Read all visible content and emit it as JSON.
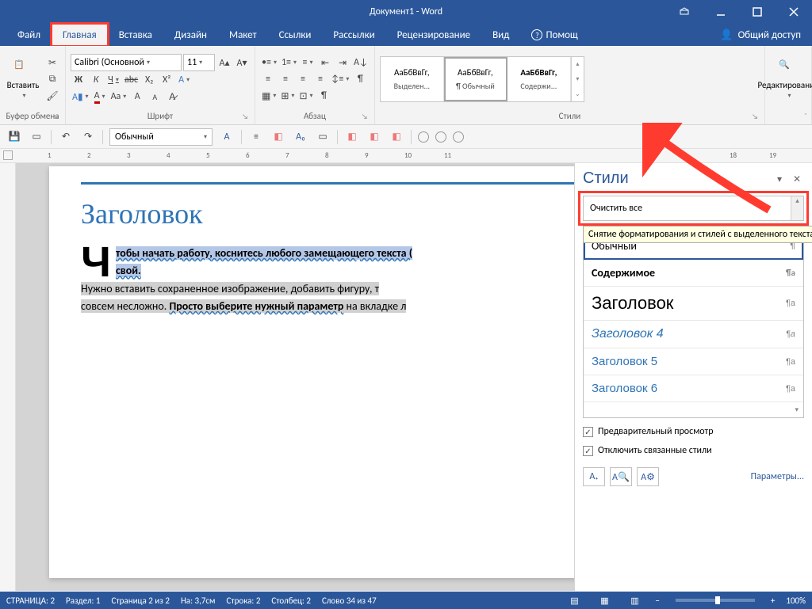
{
  "title": "Документ1 - Word",
  "tabs": [
    "Файл",
    "Главная",
    "Вставка",
    "Дизайн",
    "Макет",
    "Ссылки",
    "Рассылки",
    "Рецензирование",
    "Вид",
    "Помощ"
  ],
  "active_tab": 1,
  "share": "Общий доступ",
  "ribbon": {
    "clipboard": {
      "paste": "Вставить",
      "label": "Буфер обмена"
    },
    "font": {
      "name": "Calibri (Основной",
      "size": "11",
      "label": "Шрифт"
    },
    "para": {
      "label": "Абзац"
    },
    "styles": {
      "label": "Стили",
      "tiles": [
        {
          "preview": "АаБбВвГг,",
          "name": "Выделен..."
        },
        {
          "preview": "АаБбВвГг,",
          "name": "¶ Обычный",
          "selected": true
        },
        {
          "preview": "АаБбВвГг,",
          "name": "Содержи...",
          "bold": true
        }
      ]
    },
    "editing": {
      "label": "Редактирование"
    }
  },
  "qat_style": "Обычный",
  "ruler_numbers": [
    1,
    2,
    3,
    4,
    5,
    6,
    7,
    8,
    9,
    10,
    11,
    18,
    19
  ],
  "doc": {
    "heading": "Заголовок",
    "line1a": "тобы начать работу, коснитесь любого замещающего текста (",
    "line1b": "свой.",
    "line2a": "Нужно вставить сохраненное изображение, добавить фигуру, т",
    "line2b": "совсем несложно. ",
    "line2c": "Просто выберите нужный параметр",
    "line2d": " на вкладке л"
  },
  "pane": {
    "title": "Стили",
    "clear": "Очистить все",
    "tooltip": "Снятие форматирования и стилей с выделенного текста",
    "items": [
      {
        "label": "Обычный",
        "mark": "¶",
        "selected": true
      },
      {
        "label": "Содержимое",
        "mark": "¶a",
        "cls": "bold"
      },
      {
        "label": "Заголовок",
        "mark": "¶a",
        "cls": "h1"
      },
      {
        "label": "Заголовок 4",
        "mark": "¶a",
        "cls": "h4"
      },
      {
        "label": "Заголовок 5",
        "mark": "¶a",
        "cls": "h5"
      },
      {
        "label": "Заголовок 6",
        "mark": "¶a",
        "cls": "h6"
      }
    ],
    "chk1": "Предварительный просмотр",
    "chk2": "Отключить связанные стили",
    "params": "Параметры..."
  },
  "status": {
    "page": "СТРАНИЦА: 2",
    "section": "Раздел: 1",
    "page_of": "Страница 2 из 2",
    "at": "На: 3,7см",
    "line": "Строка: 2",
    "col": "Столбец: 2",
    "words": "Слово 34 из 47",
    "zoom": "100%"
  }
}
